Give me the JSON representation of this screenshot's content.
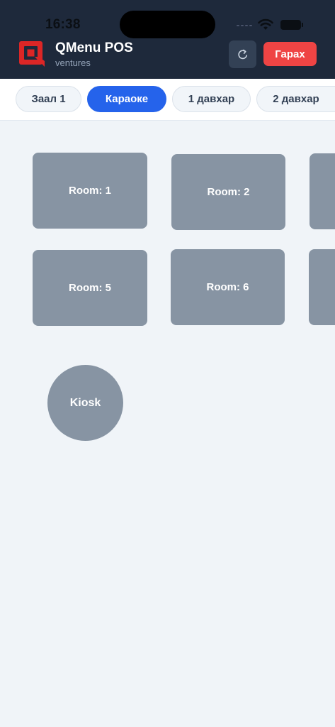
{
  "status_bar": {
    "time": "16:38"
  },
  "header": {
    "title": "QMenu POS",
    "subtitle": "ventures",
    "exit_label": "Гарах",
    "colors": {
      "header_bg": "#1e293b",
      "exit_button": "#ef4444",
      "logo": "#dc2626"
    }
  },
  "tabs": [
    {
      "label": "Заал 1",
      "active": false
    },
    {
      "label": "Караоке",
      "active": true
    },
    {
      "label": "1 давхар",
      "active": false
    },
    {
      "label": "2 давхар",
      "active": false
    }
  ],
  "rooms": [
    {
      "label": "Room: 1"
    },
    {
      "label": "Room: 2"
    },
    {
      "label": ""
    },
    {
      "label": "Room: 5"
    },
    {
      "label": "Room: 6"
    },
    {
      "label": ""
    }
  ],
  "kiosk": {
    "label": "Kiosk"
  },
  "colors": {
    "active_tab": "#2563eb",
    "room_bg": "#8794a3",
    "canvas_bg": "#f0f4f8"
  }
}
